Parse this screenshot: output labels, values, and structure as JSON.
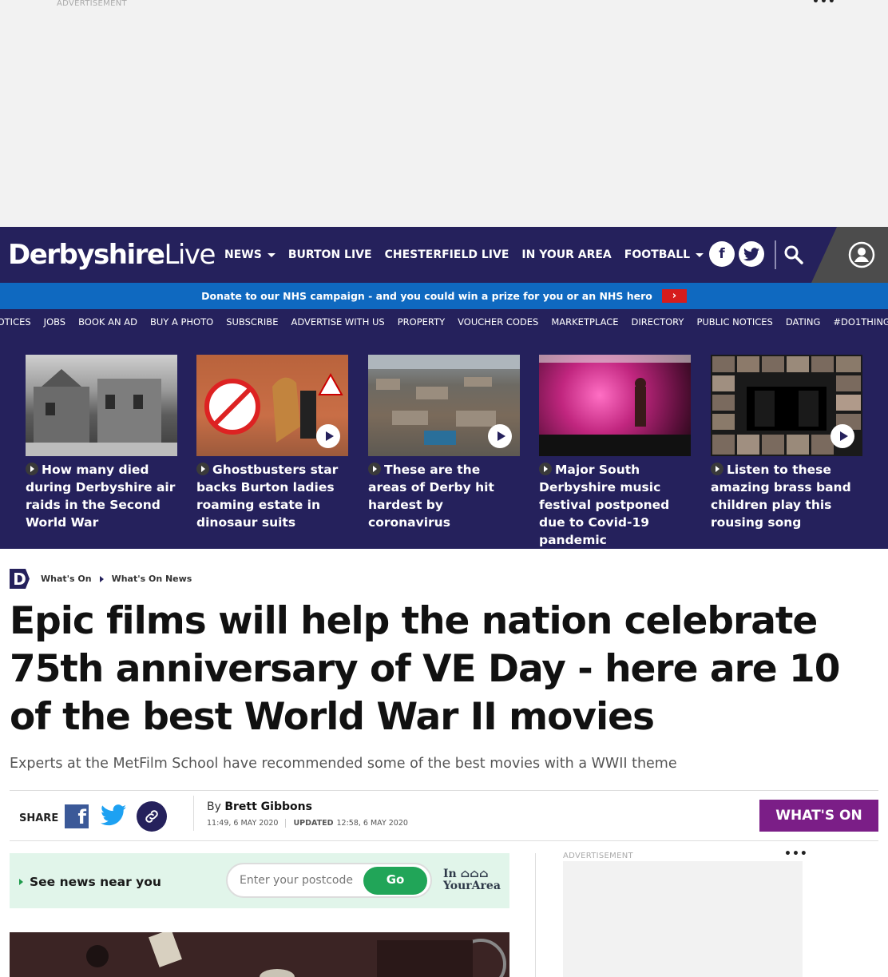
{
  "ads": {
    "top_label": "ADVERTISEMENT",
    "side_label": "ADVERTISEMENT",
    "more_glyph": "•••"
  },
  "brand": {
    "name_bold": "Derbyshire",
    "name_light": "Live",
    "colors": {
      "nav": "#25215c",
      "donate": "#0f69c0",
      "whats_on": "#7b1e87",
      "go": "#21a558"
    }
  },
  "nav": {
    "items": [
      {
        "label": "NEWS",
        "dropdown": true
      },
      {
        "label": "BURTON LIVE",
        "dropdown": false
      },
      {
        "label": "CHESTERFIELD LIVE",
        "dropdown": false
      },
      {
        "label": "IN YOUR AREA",
        "dropdown": false
      },
      {
        "label": "FOOTBALL",
        "dropdown": true
      }
    ],
    "facebook_glyph": "f",
    "icons": [
      "facebook-icon",
      "twitter-icon",
      "search-icon",
      "user-icon"
    ]
  },
  "donate": {
    "text": "Donate to our NHS campaign - and you could win a prize for you or an NHS hero",
    "button_glyph": "›"
  },
  "sublinks": [
    "NOTICES",
    "JOBS",
    "BOOK AN AD",
    "BUY A PHOTO",
    "SUBSCRIBE",
    "ADVERTISE WITH US",
    "PROPERTY",
    "VOUCHER CODES",
    "MARKETPLACE",
    "DIRECTORY",
    "PUBLIC NOTICES",
    "DATING",
    "#DO1THING"
  ],
  "featured": [
    {
      "title": "How many died during Derbyshire air raids in the Second World War",
      "video": false
    },
    {
      "title": "Ghostbusters star backs Burton ladies roaming estate in dinosaur suits",
      "video": true
    },
    {
      "title": "These are the areas of Derby hit hardest by coronavirus",
      "video": true
    },
    {
      "title": "Major South Derbyshire music festival postponed due to Covid-19 pandemic",
      "video": false
    },
    {
      "title": "Listen to these amazing brass band children play this rousing song",
      "video": true
    }
  ],
  "breadcrumb": {
    "logo_letter": "D",
    "items": [
      "What's On",
      "What's On News"
    ]
  },
  "article": {
    "headline": "Epic films will help the nation celebrate 75th anniversary of VE Day - here are 10 of the best World War II movies",
    "standfirst": "Experts at the MetFilm School have recommended some of the best movies with a WWII theme",
    "share_label": "SHARE",
    "by_prefix": "By",
    "author": "Brett Gibbons",
    "published": "11:49, 6 MAY 2020",
    "updated_label": "UPDATED",
    "updated": "12:58, 6 MAY 2020",
    "section_button": "WHAT'S ON",
    "fb_glyph": "f"
  },
  "near_you": {
    "label": "See news near you",
    "placeholder": "Enter your postcode",
    "go_label": "Go",
    "brand_line1": "In ⌂⌂⌂",
    "brand_line2": "YourArea"
  }
}
